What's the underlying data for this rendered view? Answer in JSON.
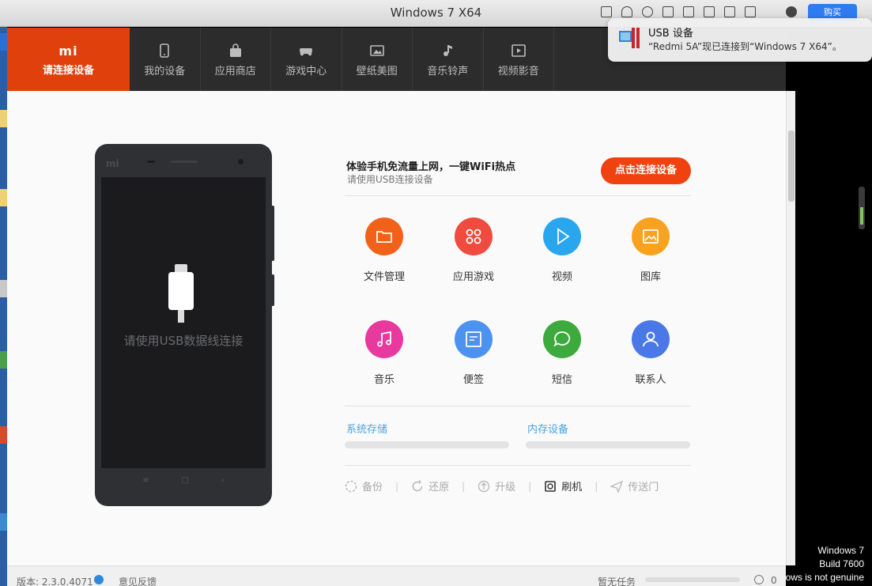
{
  "host": {
    "title": "Windows 7 X64",
    "buy_label": "购买"
  },
  "notification": {
    "title": "USB 设备",
    "body": "“Redmi 5A”现已连接到“Windows 7 X64”。"
  },
  "nav": {
    "brand_logo": "mi",
    "brand_label": "请连接设备",
    "items": [
      {
        "label": "我的设备",
        "icon": "phone-icon"
      },
      {
        "label": "应用商店",
        "icon": "bag-icon"
      },
      {
        "label": "游戏中心",
        "icon": "gamepad-icon"
      },
      {
        "label": "壁纸美图",
        "icon": "picture-icon"
      },
      {
        "label": "音乐铃声",
        "icon": "music-note-icon"
      },
      {
        "label": "视频影音",
        "icon": "video-play-icon"
      }
    ]
  },
  "phone": {
    "logo": "mi",
    "hint": "请使用USB数据线连接"
  },
  "promo": {
    "title": "体验手机免流量上网，一键WiFi热点",
    "subtitle": "请使用USB连接设备",
    "connect_button": "点击连接设备"
  },
  "tiles": [
    {
      "label": "文件管理",
      "icon": "folder-icon",
      "color": "#f2611a"
    },
    {
      "label": "应用游戏",
      "icon": "apps-icon",
      "color": "#ef4b3f"
    },
    {
      "label": "视频",
      "icon": "play-icon",
      "color": "#2aa6ef"
    },
    {
      "label": "图库",
      "icon": "gallery-icon",
      "color": "#f9a21f"
    },
    {
      "label": "音乐",
      "icon": "music-icon",
      "color": "#e8399e"
    },
    {
      "label": "便签",
      "icon": "notes-icon",
      "color": "#4b93ee"
    },
    {
      "label": "短信",
      "icon": "message-icon",
      "color": "#3caa3c"
    },
    {
      "label": "联系人",
      "icon": "contact-icon",
      "color": "#4a78e6"
    }
  ],
  "storage": {
    "system_label": "系统存储",
    "internal_label": "内存设备"
  },
  "actions": [
    {
      "label": "备份",
      "icon": "backup-icon",
      "active": false
    },
    {
      "label": "还原",
      "icon": "restore-icon",
      "active": false
    },
    {
      "label": "升级",
      "icon": "upgrade-icon",
      "active": false
    },
    {
      "label": "刷机",
      "icon": "flash-icon",
      "active": true
    },
    {
      "label": "传送门",
      "icon": "send-icon",
      "active": false
    }
  ],
  "statusbar": {
    "version": "版本: 2.3.0.4071",
    "feedback": "意见反馈",
    "task": "暂无任务",
    "count": "0"
  },
  "watermark": {
    "line1": "Windows 7",
    "line2": "Build 7600",
    "line3": "ows is not genuine"
  }
}
